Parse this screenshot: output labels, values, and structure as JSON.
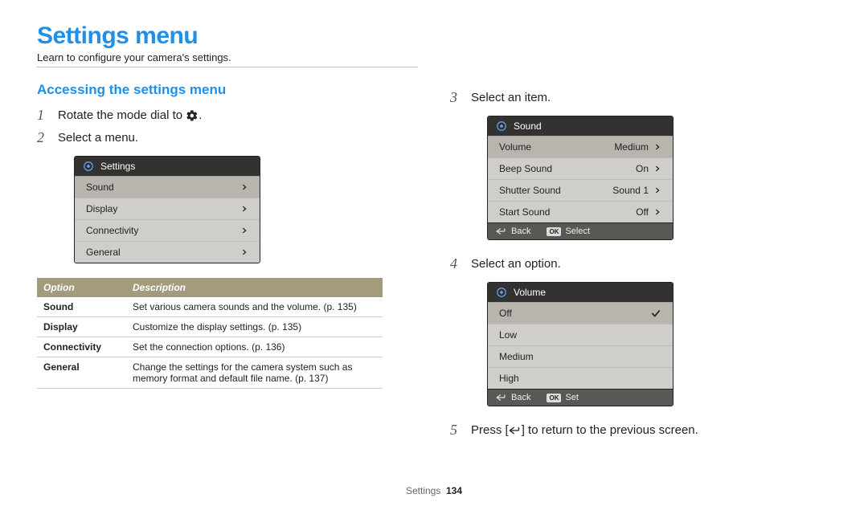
{
  "header": {
    "title": "Settings menu",
    "subtitle": "Learn to configure your camera's settings."
  },
  "accessing": {
    "heading": "Accessing the settings menu",
    "step1_prefix": "Rotate the mode dial to ",
    "step1_suffix": ".",
    "step2": "Select a menu.",
    "step3": "Select an item.",
    "step4": "Select an option.",
    "step5_prefix": "Press [",
    "step5_suffix": "] to return to the previous screen."
  },
  "panel_settings": {
    "title": "Settings",
    "items": [
      "Sound",
      "Display",
      "Connectivity",
      "General"
    ]
  },
  "panel_sound": {
    "title": "Sound",
    "items": [
      {
        "label": "Volume",
        "value": "Medium"
      },
      {
        "label": "Beep Sound",
        "value": "On"
      },
      {
        "label": "Shutter Sound",
        "value": "Sound 1"
      },
      {
        "label": "Start Sound",
        "value": "Off"
      }
    ],
    "footer_back": "Back",
    "footer_select": "Select"
  },
  "panel_volume": {
    "title": "Volume",
    "items": [
      "Off",
      "Low",
      "Medium",
      "High"
    ],
    "footer_back": "Back",
    "footer_set": "Set"
  },
  "options_table": {
    "col1": "Option",
    "col2": "Description",
    "rows": [
      {
        "opt": "Sound",
        "desc": "Set various camera sounds and the volume. (p. 135)"
      },
      {
        "opt": "Display",
        "desc": "Customize the display settings. (p. 135)"
      },
      {
        "opt": "Connectivity",
        "desc": "Set the connection options. (p. 136)"
      },
      {
        "opt": "General",
        "desc": "Change the settings for the camera system such as memory format and default file name. (p. 137)"
      }
    ]
  },
  "footer": {
    "section": "Settings",
    "page": "134"
  },
  "ok_label": "OK"
}
